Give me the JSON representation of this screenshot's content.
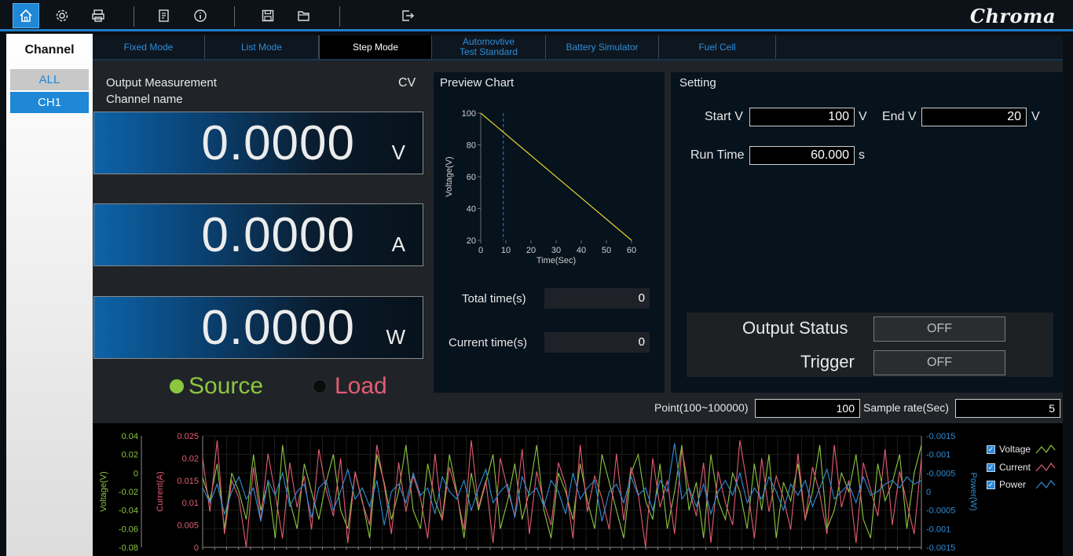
{
  "toolbar": {
    "icons": [
      "home-icon",
      "settings-icon",
      "print-icon",
      "report-icon",
      "info-icon",
      "save-icon",
      "open-folder-icon",
      "exit-icon"
    ],
    "brand": "Chroma"
  },
  "sidebar": {
    "title": "Channel",
    "items": [
      {
        "label": "ALL",
        "selected": false
      },
      {
        "label": "CH1",
        "selected": true
      }
    ]
  },
  "tabs": [
    {
      "label": "Fixed Mode",
      "active": false
    },
    {
      "label": "List Mode",
      "active": false
    },
    {
      "label": "Step Mode",
      "active": true
    },
    {
      "label": "Automovtive\nTest Standard",
      "active": false
    },
    {
      "label": "Battery Simulator",
      "active": false
    },
    {
      "label": "Fuel Cell",
      "active": false
    }
  ],
  "output": {
    "title": "Output Measurement",
    "mode": "CV",
    "channel_label": "Channel name",
    "voltage": {
      "value": "0.0000",
      "unit": "V"
    },
    "current": {
      "value": "0.0000",
      "unit": "A"
    },
    "power": {
      "value": "0.0000",
      "unit": "W"
    },
    "source_label": "Source",
    "load_label": "Load",
    "source_selected": true,
    "source_color": "#8cc63f",
    "load_color": "#e45c73"
  },
  "preview": {
    "title": "Preview Chart",
    "total_time_label": "Total time(s)",
    "total_time_value": "0",
    "current_time_label": "Current time(s)",
    "current_time_value": "0"
  },
  "setting": {
    "title": "Setting",
    "start_v_label": "Start V",
    "start_v_value": "100",
    "start_v_unit": "V",
    "end_v_label": "End V",
    "end_v_value": "20",
    "end_v_unit": "V",
    "run_time_label": "Run Time",
    "run_time_value": "60.000",
    "run_time_unit": "s",
    "output_status_label": "Output Status",
    "output_status_value": "OFF",
    "trigger_label": "Trigger",
    "trigger_value": "OFF"
  },
  "sampling": {
    "point_label": "Point(100~100000)",
    "point_value": "100",
    "sample_rate_label": "Sample rate(Sec)",
    "sample_rate_value": "5"
  },
  "chart_data": [
    {
      "type": "line",
      "title": "",
      "xlabel": "Time(Sec)",
      "ylabel": "Voltage(V)",
      "x": [
        0,
        60
      ],
      "y": [
        100,
        20
      ],
      "xlim": [
        0,
        60
      ],
      "ylim": [
        20,
        100
      ],
      "xticks": [
        "0",
        "10",
        "20",
        "30",
        "40",
        "50",
        "60"
      ],
      "yticks": [
        "20",
        "40",
        "60",
        "80",
        "100"
      ],
      "series_color": "#e6d22a",
      "marker_x": 9,
      "marker_color": "#3a7fd0",
      "grid": false
    },
    {
      "type": "line",
      "title": "",
      "ylabel_left1": "Voltage(V)",
      "ylabel_left2": "Current(A)",
      "ylabel_right": "Power(W)",
      "yticks_voltage": [
        "0.04",
        "0.02",
        "0",
        "-0.02",
        "-0.04",
        "-0.06",
        "-0.08"
      ],
      "yticks_current": [
        "0.025",
        "0.02",
        "0.015",
        "0.01",
        "0.005",
        "0"
      ],
      "yticks_power": [
        "-0.0015",
        "-0.001",
        "-0.0005",
        "0",
        "-0.0005",
        "-0.001",
        "-0.0015"
      ],
      "ylim_voltage": [
        -0.08,
        0.04
      ],
      "ylim_current": [
        0,
        0.025
      ],
      "ylim_power": [
        -0.0015,
        0.0015
      ],
      "legend_position": "right",
      "grid": true,
      "series": [
        {
          "name": "Voltage",
          "color": "#8cc63f",
          "values": [
            -0.005,
            -0.03,
            0.01,
            -0.06,
            0.0,
            -0.02,
            -0.05,
            0.02,
            -0.04,
            -0.01,
            -0.07,
            0.03,
            -0.03,
            -0.06,
            0.01,
            -0.02,
            -0.05,
            -0.01,
            0.02,
            -0.04,
            -0.06,
            0.0,
            -0.03,
            -0.07,
            0.02,
            -0.01,
            -0.05,
            -0.02,
            0.03,
            -0.04,
            -0.06,
            0.01,
            -0.03,
            -0.05,
            0.02,
            -0.02,
            -0.07,
            0.0,
            -0.04,
            -0.01,
            0.02,
            -0.06,
            -0.03,
            0.01,
            -0.05,
            -0.02,
            0.03,
            -0.04,
            -0.07,
            0.0,
            -0.02,
            -0.05,
            0.01,
            -0.03,
            -0.06,
            0.02,
            -0.01,
            -0.04,
            -0.07,
            0.0,
            0.02,
            -0.03,
            -0.05,
            0.01,
            -0.06,
            -0.02,
            0.03,
            -0.04,
            -0.01,
            -0.07,
            0.02,
            -0.03,
            -0.05,
            0.0,
            -0.02,
            -0.06,
            0.01,
            -0.04,
            0.02,
            -0.07,
            -0.01,
            -0.03,
            0.01,
            -0.05,
            -0.02,
            0.03,
            -0.06,
            -0.04,
            0.0,
            -0.02,
            0.02,
            -0.05,
            -0.07,
            0.01,
            -0.03,
            -0.01,
            0.02,
            -0.06,
            0.0,
            0.03
          ]
        },
        {
          "name": "Current",
          "color": "#e45c73",
          "values": [
            0.02,
            0.008,
            0.024,
            0.003,
            0.015,
            0.011,
            0.0,
            0.018,
            0.006,
            0.021,
            0.012,
            0.002,
            0.019,
            0.009,
            0.016,
            0.004,
            0.022,
            0.013,
            0.007,
            0.02,
            0.001,
            0.017,
            0.01,
            0.005,
            0.023,
            0.014,
            0.003,
            0.019,
            0.008,
            0.016,
            0.011,
            0.002,
            0.021,
            0.006,
            0.018,
            0.012,
            0.004,
            0.024,
            0.009,
            0.015,
            0.001,
            0.02,
            0.013,
            0.007,
            0.022,
            0.003,
            0.017,
            0.01,
            0.005,
            0.019,
            0.014,
            0.002,
            0.023,
            0.008,
            0.016,
            0.011,
            0.004,
            0.021,
            0.006,
            0.018,
            0.012,
            0.0,
            0.02,
            0.009,
            0.015,
            0.003,
            0.022,
            0.013,
            0.007,
            0.019,
            0.001,
            0.017,
            0.01,
            0.005,
            0.024,
            0.014,
            0.002,
            0.02,
            0.008,
            0.016,
            0.011,
            0.004,
            0.021,
            0.006,
            0.018,
            0.012,
            0.003,
            0.023,
            0.009,
            0.015,
            0.001,
            0.019,
            0.013,
            0.007,
            0.022,
            0.005,
            0.017,
            0.01,
            0.003,
            0.02
          ]
        },
        {
          "name": "Power",
          "color": "#2e8ed8",
          "values": [
            0.0001,
            -0.0003,
            0.0002,
            -0.0006,
            0.0,
            0.0004,
            -0.0002,
            0.0001,
            -0.0008,
            0.0003,
            -0.0001,
            0.0005,
            -0.0004,
            0.0,
            0.0002,
            -0.0007,
            0.0001,
            0.0003,
            -0.0005,
            0.0,
            0.0006,
            -0.0002,
            0.0001,
            -0.0004,
            0.0003,
            -0.0009,
            0.0,
            0.0002,
            -0.0003,
            0.0005,
            -0.0001,
            0.0001,
            -0.0006,
            0.0004,
            0.0,
            -0.0002,
            0.0003,
            -0.0005,
            0.0001,
            0.0006,
            -0.0003,
            0.0,
            0.0002,
            -0.0007,
            0.0004,
            -0.0001,
            0.0001,
            -0.0004,
            0.0003,
            0.0,
            -0.0006,
            0.0005,
            -0.0002,
            0.0001,
            0.0003,
            -0.0008,
            0.0,
            0.0002,
            -0.0003,
            0.0004,
            -0.0001,
            0.0001,
            -0.0005,
            0.0003,
            0.0,
            0.0013,
            -0.0002,
            0.0001,
            -0.0004,
            0.0002,
            -0.0006,
            0.0,
            0.0003,
            -0.0001,
            0.0005,
            -0.0003,
            0.0001,
            -0.0002,
            0.0004,
            0.0,
            -0.0005,
            0.0002,
            -0.0001,
            0.0003,
            -0.0004,
            0.0001,
            0.0006,
            -0.0002,
            0.0,
            0.0002,
            -0.0003,
            0.0004,
            -0.0001,
            0.0,
            0.0002,
            0.0003,
            0.0001,
            0.0004,
            0.0002,
            0.0003
          ]
        }
      ]
    }
  ]
}
